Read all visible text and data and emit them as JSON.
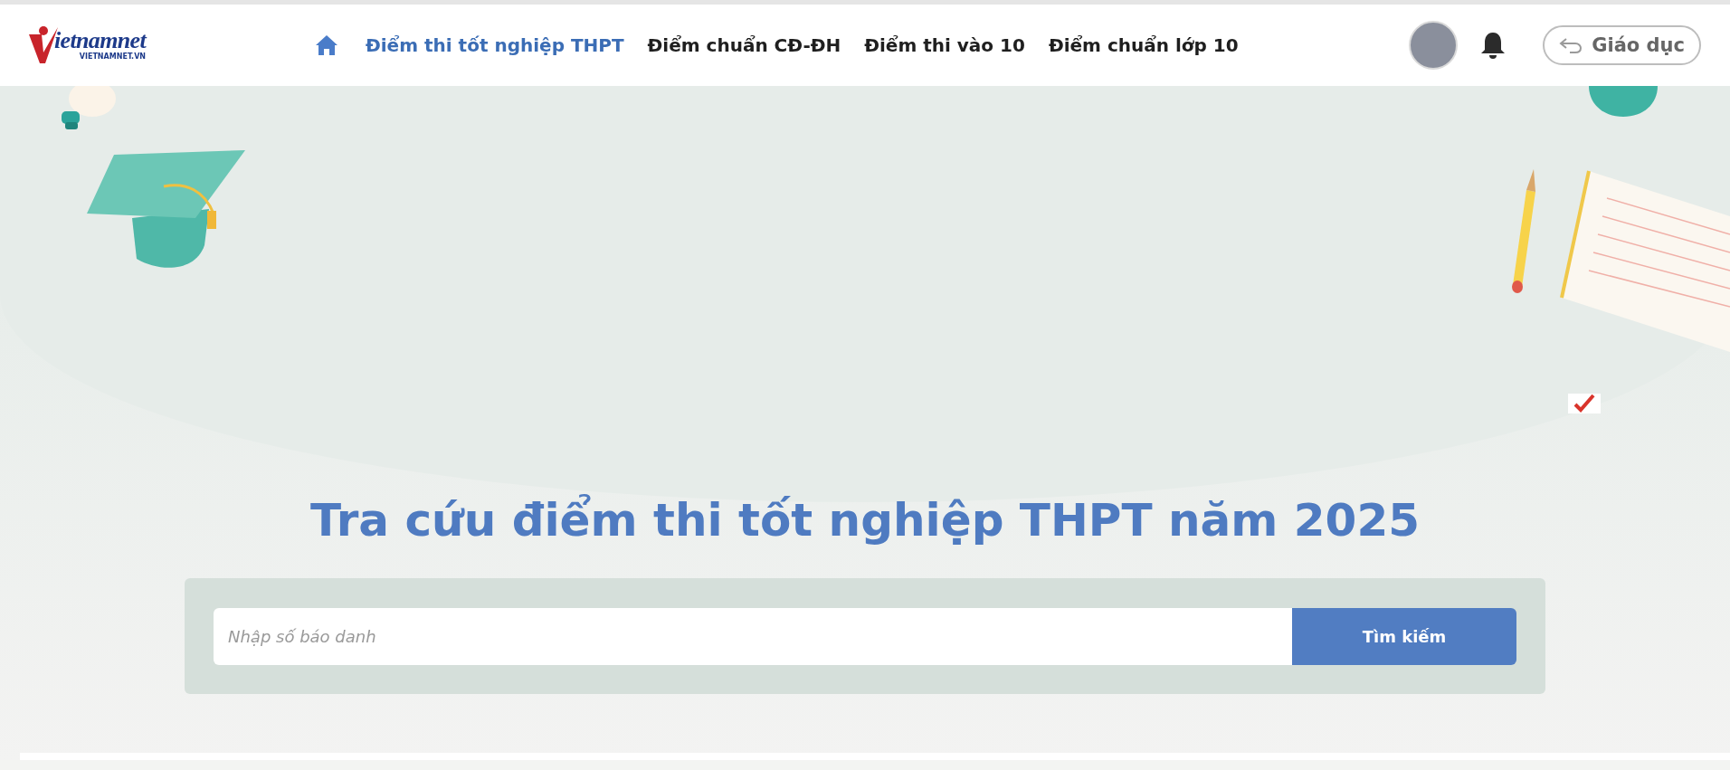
{
  "logo": {
    "wordmark": "ietnamnet",
    "domain": "VIETNAMNET.VN"
  },
  "nav": [
    {
      "label": "Điểm thi tốt nghiệp THPT",
      "selected": true
    },
    {
      "label": "Điểm chuẩn CĐ-ĐH",
      "selected": false
    },
    {
      "label": "Điểm thi vào 10",
      "selected": false
    },
    {
      "label": "Điểm chuẩn lớp 10",
      "selected": false
    }
  ],
  "back_button": {
    "label": "Giáo dục"
  },
  "hero": {
    "title": "Tra cứu điểm thi tốt nghiệp THPT năm 2025"
  },
  "search": {
    "placeholder": "Nhập số báo danh",
    "button": "Tìm kiếm"
  }
}
